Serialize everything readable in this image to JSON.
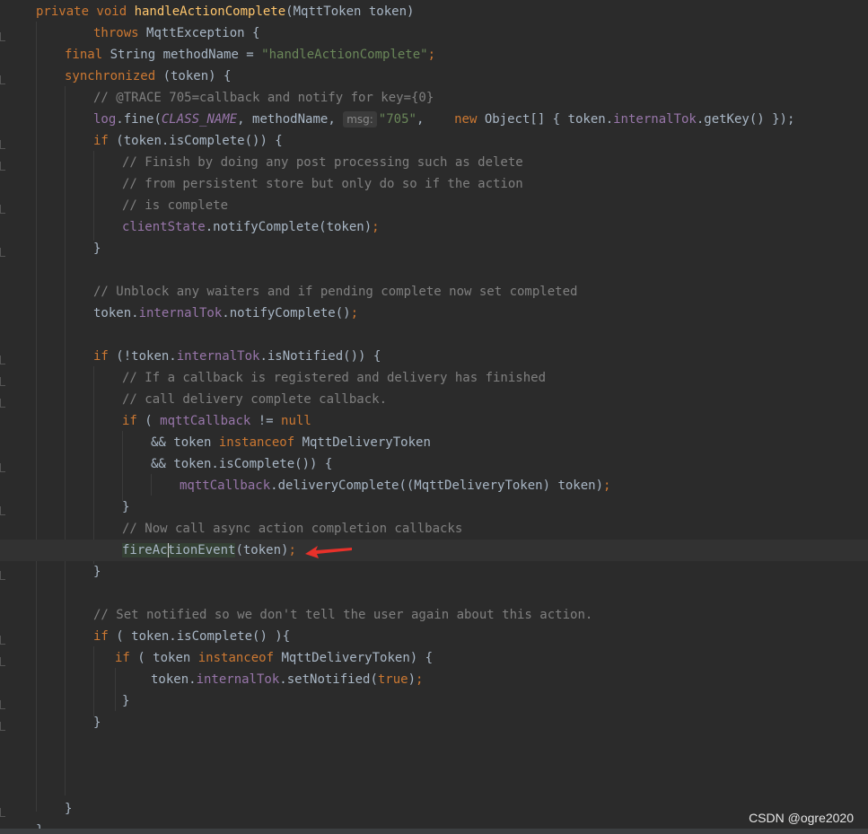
{
  "code": {
    "l1": {
      "a": "private void ",
      "b": "handleActionComplete",
      "c": "(MqttToken token)"
    },
    "l2": {
      "a": "throws ",
      "b": "MqttException {"
    },
    "l3": {
      "a": "final ",
      "b": "String methodName = ",
      "c": "\"handleActionComplete\"",
      "d": ";"
    },
    "l4": {
      "a": "synchronized ",
      "b": "(token) {"
    },
    "l5": "// @TRACE 705=callback and notify for key={0}",
    "l6": {
      "a": "log",
      "b": ".fine(",
      "c": "CLASS_NAME",
      "d": ", methodName, ",
      "hint": "msg:",
      "e": "\"705\"",
      "f": ",    ",
      "g": "new ",
      "h": "Object[] { token.",
      "i": "internalTok",
      ".j": "",
      "j": ".getKey() });"
    },
    "l7": {
      "a": "if ",
      "b": "(token.isComplete()) {"
    },
    "l8": "// Finish by doing any post processing such as delete",
    "l9": "// from persistent store but only do so if the action",
    "l10": "// is complete",
    "l11": {
      "a": "clientState",
      "b": ".notifyComplete(token)",
      "c": ";"
    },
    "l12": "}",
    "l13": "// Unblock any waiters and if pending complete now set completed",
    "l14": {
      "a": "token.",
      "b": "internalTok",
      "c": ".notifyComplete()",
      "d": ";"
    },
    "l15": {
      "a": "if ",
      "b": "(!token.",
      "c": "internalTok",
      "d": ".isNotified()) {"
    },
    "l16": "// If a callback is registered and delivery has finished",
    "l17": "// call delivery complete callback.",
    "l18": {
      "a": "if ",
      "b": "( ",
      "c": "mqttCallback",
      "d": " != ",
      "e": "null"
    },
    "l19": {
      "a": "&& token ",
      "b": "instanceof ",
      "c": "MqttDeliveryToken"
    },
    "l20": {
      "a": "&& token.isComplete()) {"
    },
    "l21": {
      "a": "mqttCallback",
      "b": ".deliveryComplete((MqttDeliveryToken) token)",
      "c": ";"
    },
    "l22": "}",
    "l23": "// Now call async action completion callbacks",
    "l24": {
      "a1": "fireAc",
      "a2": "tionEvent",
      "b": "(token)",
      "c": ";"
    },
    "l25": "}",
    "l26": "// Set notified so we don't tell the user again about this action.",
    "l27": {
      "a": "if ",
      "b": "( token.isComplete() ){"
    },
    "l28": {
      "a": "if ",
      "b": "( token ",
      "c": "instanceof ",
      "d": "MqttDeliveryToken) {"
    },
    "l29": {
      "a": "token.",
      "b": "internalTok",
      "c": ".setNotified(",
      "d": "true",
      "e": ")",
      "f": ";"
    },
    "l30": "}",
    "l31": "}",
    "l32": "}",
    "l33": "}"
  },
  "colors": {
    "background": "#2b2b2b",
    "keyword": "#cc7832",
    "method": "#ffc66d",
    "string": "#6a8759",
    "comment": "#808080",
    "field": "#9876aa",
    "arrow": "#e8312a"
  },
  "icons": {
    "annotation": "red-arrow-icon"
  },
  "watermark": "CSDN @ogre2020"
}
